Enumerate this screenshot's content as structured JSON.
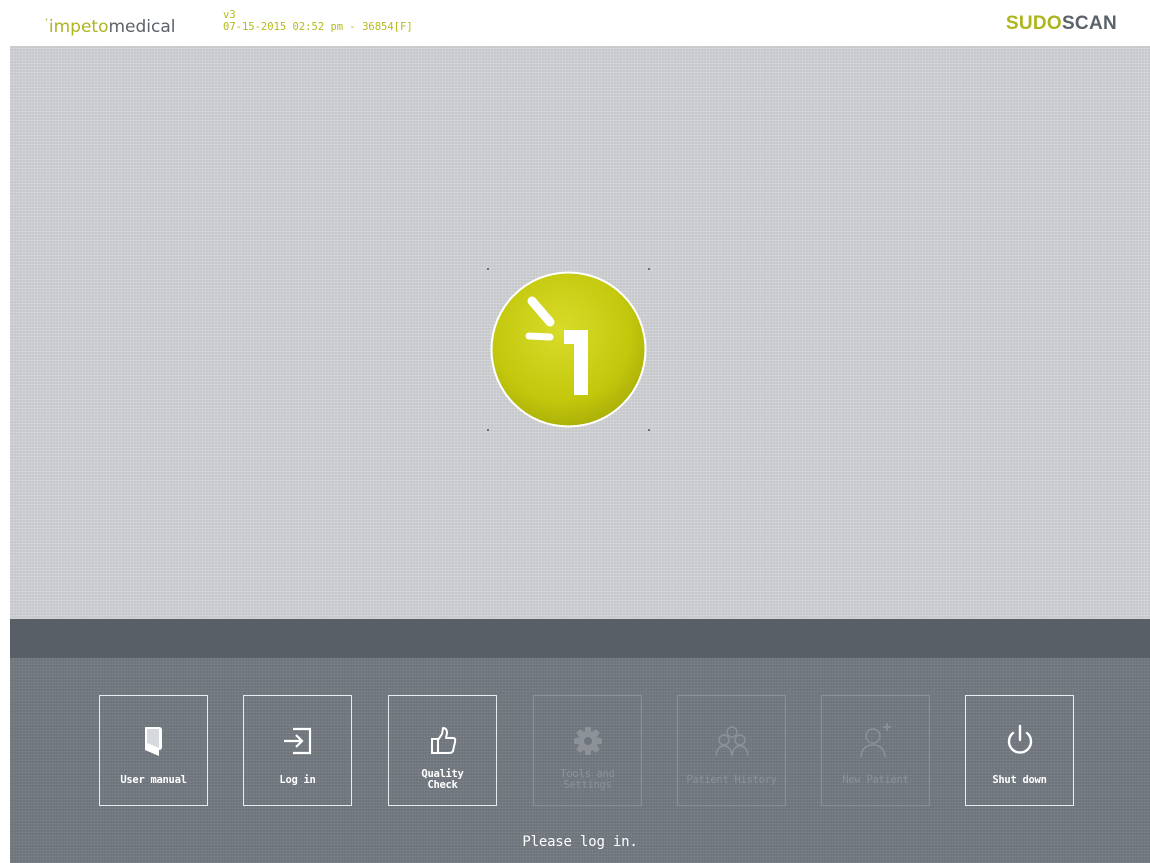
{
  "header": {
    "brand_mark": "ʼ",
    "brand_part1": "impeto",
    "brand_part2": "medical",
    "version": "v3",
    "build_info": "07-15-2015 02:52 pm - 36854[F]",
    "product_part1": "SUDO",
    "product_part2": "SCAN"
  },
  "center_logo": {
    "icon": "impeto-i-logo",
    "color": "#c7cc0e"
  },
  "toolbar": {
    "buttons": [
      {
        "label": "User manual",
        "icon": "book-icon",
        "enabled": true
      },
      {
        "label": "Log in",
        "icon": "login-icon",
        "enabled": true
      },
      {
        "label": "Quality\nCheck",
        "icon": "thumbs-up-icon",
        "enabled": true
      },
      {
        "label": "Tools and\nSettings",
        "icon": "gear-icon",
        "enabled": false
      },
      {
        "label": "Patient History",
        "icon": "patients-icon",
        "enabled": false
      },
      {
        "label": "New Patient",
        "icon": "add-patient-icon",
        "enabled": false
      },
      {
        "label": "Shut down",
        "icon": "power-icon",
        "enabled": true
      }
    ]
  },
  "status": {
    "message": "Please log in."
  },
  "colors": {
    "accent": "#aeb51f",
    "main_bg": "#c6c8cc",
    "separator": "#585f66",
    "toolbar_bg": "#6f757c"
  }
}
